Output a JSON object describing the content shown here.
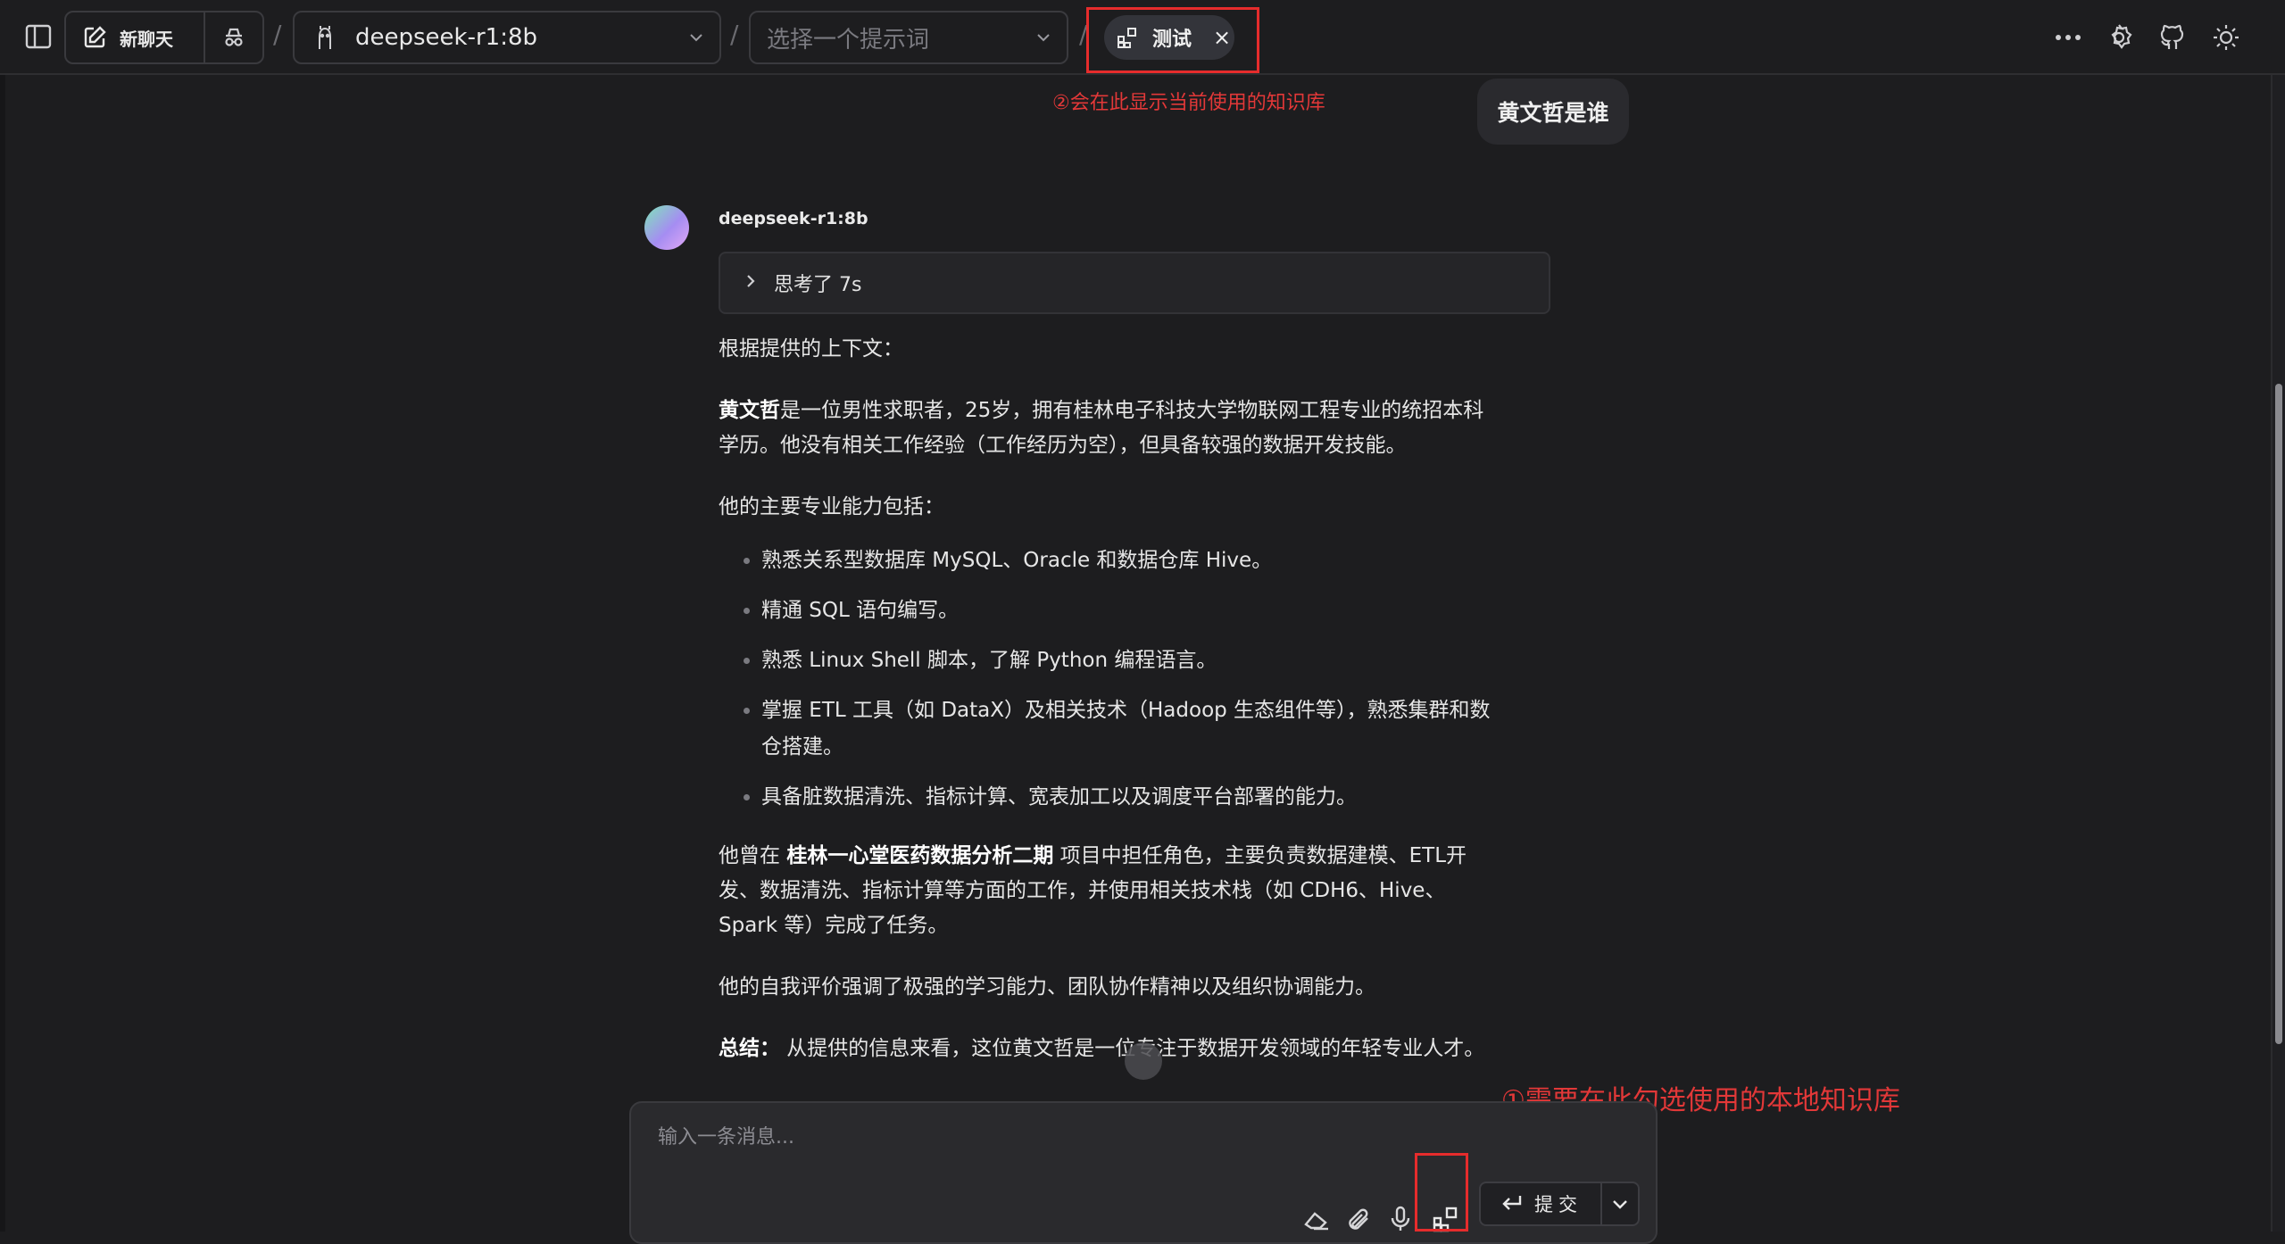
{
  "topbar": {
    "new_chat_label": "新聊天",
    "model_name": "deepseek-r1:8b",
    "prompt_placeholder": "选择一个提示词",
    "kb_tag_label": "测试",
    "kb_tag_close": "×",
    "separator": "/"
  },
  "annotations": {
    "top_note": "②会在此显示当前使用的知识库",
    "bottom_note": "①需要在此勾选使用的本地知识库"
  },
  "chat": {
    "user_message": "黄文哲是谁",
    "assistant_model": "deepseek-r1:8b",
    "think_label": "思考了 7s",
    "intro": "根据提供的上下文：",
    "p1_bold": "黄文哲",
    "p1_rest": "是一位男性求职者，25岁，拥有桂林电子科技大学物联网工程专业的统招本科学历。他没有相关工作经验（工作经历为空），但具备较强的数据开发技能。",
    "skills_heading": "他的主要专业能力包括：",
    "skills": [
      "熟悉关系型数据库 MySQL、Oracle 和数据仓库 Hive。",
      "精通 SQL 语句编写。",
      "熟悉 Linux Shell 脚本，了解 Python 编程语言。",
      "掌握 ETL 工具（如 DataX）及相关技术（Hadoop 生态组件等），熟悉集群和数仓搭建。",
      "具备脏数据清洗、指标计算、宽表加工以及调度平台部署的能力。"
    ],
    "p_project_pre": "他曾在 ",
    "p_project_bold": "桂林一心堂医药数据分析二期",
    "p_project_post": " 项目中担任角色，主要负责数据建模、ETL开发、数据清洗、指标计算等方面的工作，并使用相关技术栈（如 CDH6、Hive、Spark 等）完成了任务。",
    "p_self": "他的自我评价强调了极强的学习能力、团队协作精神以及组织协调能力。",
    "summary_bold": "总结：",
    "summary_rest": " 从提供的信息来看，这位黄文哲是一位专注于数据开发领域的年轻专业人才。"
  },
  "composer": {
    "placeholder": "输入一条消息...",
    "submit_label": "提交"
  },
  "colors": {
    "annotation_red": "#e62c2c",
    "background": "#1d1d1f"
  }
}
